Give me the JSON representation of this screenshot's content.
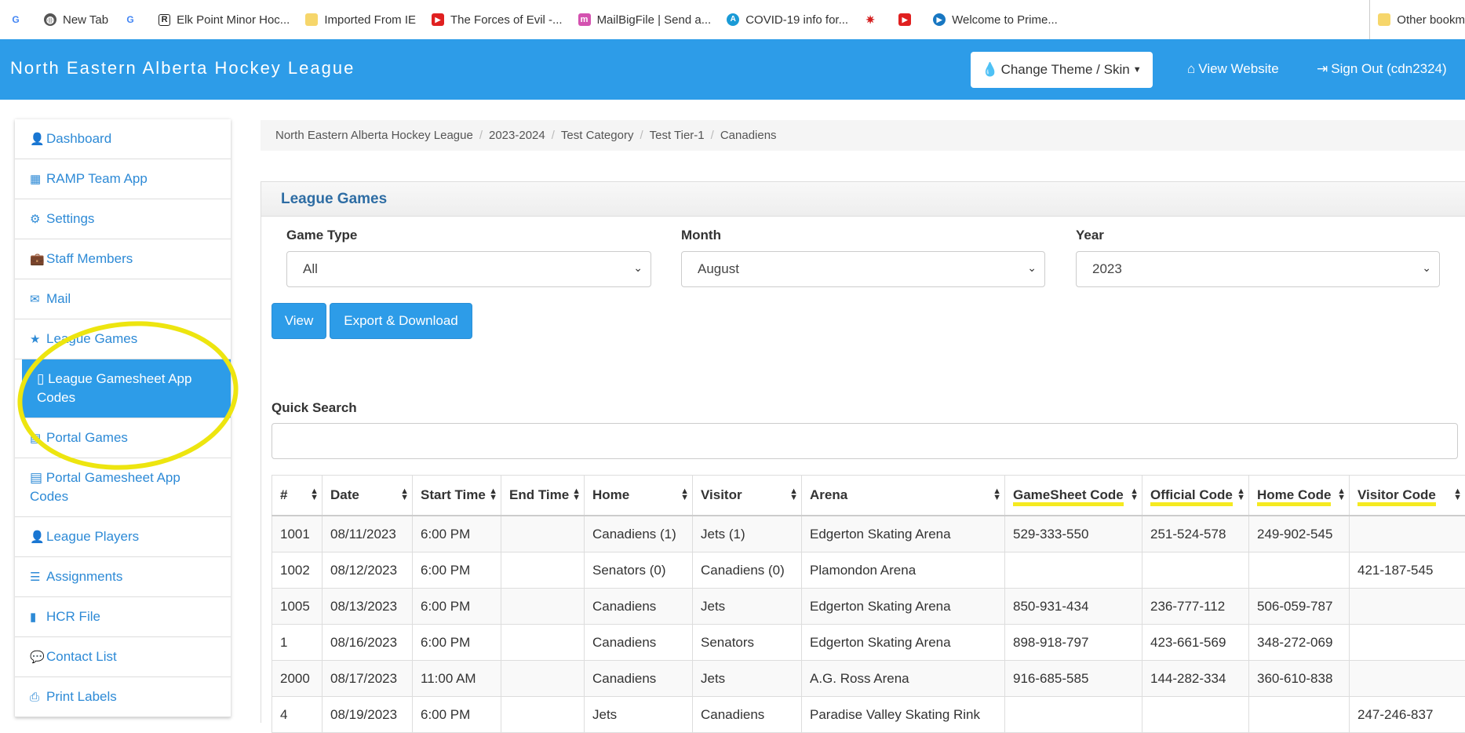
{
  "bookmarks": [
    {
      "icon": "google-icon",
      "label": ""
    },
    {
      "icon": "globe-icon",
      "label": "New Tab"
    },
    {
      "icon": "google-icon",
      "label": ""
    },
    {
      "icon": "ramp-icon",
      "label": "Elk Point Minor Hoc..."
    },
    {
      "icon": "folder-icon",
      "label": "Imported From IE"
    },
    {
      "icon": "youtube-icon",
      "label": "The Forces of Evil -..."
    },
    {
      "icon": "mailbigfile-icon",
      "label": "MailBigFile | Send a..."
    },
    {
      "icon": "alberta-icon",
      "label": "COVID-19 info for..."
    },
    {
      "icon": "canada-icon",
      "label": ""
    },
    {
      "icon": "youtube-icon",
      "label": ""
    },
    {
      "icon": "prime-icon",
      "label": "Welcome to Prime..."
    }
  ],
  "bookmarks_other": "Other bookm",
  "header": {
    "brand": "North Eastern Alberta Hockey League",
    "theme_button": "Change Theme / Skin",
    "view_website": "View Website",
    "sign_out": "Sign Out (cdn2324)"
  },
  "sidebar": {
    "items": [
      {
        "label": "Dashboard",
        "icon": "user-icon"
      },
      {
        "label": "RAMP Team App",
        "icon": "grid-icon"
      },
      {
        "label": "Settings",
        "icon": "gear-icon"
      },
      {
        "label": "Staff Members",
        "icon": "briefcase-icon"
      },
      {
        "label": "Mail",
        "icon": "envelope-icon"
      },
      {
        "label": "League Games",
        "icon": "star-icon"
      },
      {
        "label": "League Gamesheet App Codes",
        "icon": "mobile-icon"
      },
      {
        "label": "Portal Games",
        "icon": "calendar-icon"
      },
      {
        "label": "Portal Gamesheet App Codes",
        "icon": "calendar-icon"
      },
      {
        "label": "League Players",
        "icon": "user-icon"
      },
      {
        "label": "Assignments",
        "icon": "list-icon"
      },
      {
        "label": "HCR File",
        "icon": "file-icon"
      },
      {
        "label": "Contact List",
        "icon": "comment-icon"
      },
      {
        "label": "Print Labels",
        "icon": "print-icon"
      }
    ],
    "active_index": 6
  },
  "breadcrumb": [
    "North Eastern Alberta Hockey League",
    "2023-2024",
    "Test Category",
    "Test Tier-1",
    "Canadiens"
  ],
  "panel": {
    "title": "League Games",
    "filters": {
      "game_type": {
        "label": "Game Type",
        "value": "All"
      },
      "month": {
        "label": "Month",
        "value": "August"
      },
      "year": {
        "label": "Year",
        "value": "2023"
      }
    },
    "view_button": "View",
    "export_button": "Export & Download",
    "quick_search_label": "Quick Search",
    "quick_search_value": ""
  },
  "table": {
    "columns": [
      "#",
      "Date",
      "Start Time",
      "End Time",
      "Home",
      "Visitor",
      "Arena",
      "GameSheet Code",
      "Official Code",
      "Home Code",
      "Visitor Code"
    ],
    "rows": [
      [
        "1001",
        "08/11/2023",
        "6:00 PM",
        "",
        "Canadiens (1)",
        "Jets (1)",
        "Edgerton Skating Arena",
        "529-333-550",
        "251-524-578",
        "249-902-545",
        ""
      ],
      [
        "1002",
        "08/12/2023",
        "6:00 PM",
        "",
        "Senators (0)",
        "Canadiens (0)",
        "Plamondon Arena",
        "",
        "",
        "",
        "421-187-545"
      ],
      [
        "1005",
        "08/13/2023",
        "6:00 PM",
        "",
        "Canadiens",
        "Jets",
        "Edgerton Skating Arena",
        "850-931-434",
        "236-777-112",
        "506-059-787",
        ""
      ],
      [
        "1",
        "08/16/2023",
        "6:00 PM",
        "",
        "Canadiens",
        "Senators",
        "Edgerton Skating Arena",
        "898-918-797",
        "423-661-569",
        "348-272-069",
        ""
      ],
      [
        "2000",
        "08/17/2023",
        "11:00 AM",
        "",
        "Canadiens",
        "Jets",
        "A.G. Ross Arena",
        "916-685-585",
        "144-282-334",
        "360-610-838",
        ""
      ],
      [
        "4",
        "08/19/2023",
        "6:00 PM",
        "",
        "Jets",
        "Canadiens",
        "Paradise Valley Skating Rink",
        "",
        "",
        "",
        "247-246-837"
      ]
    ]
  },
  "colors": {
    "accent": "#2d9ce8",
    "highlight": "#ede50f",
    "link": "#2d8ad6"
  }
}
